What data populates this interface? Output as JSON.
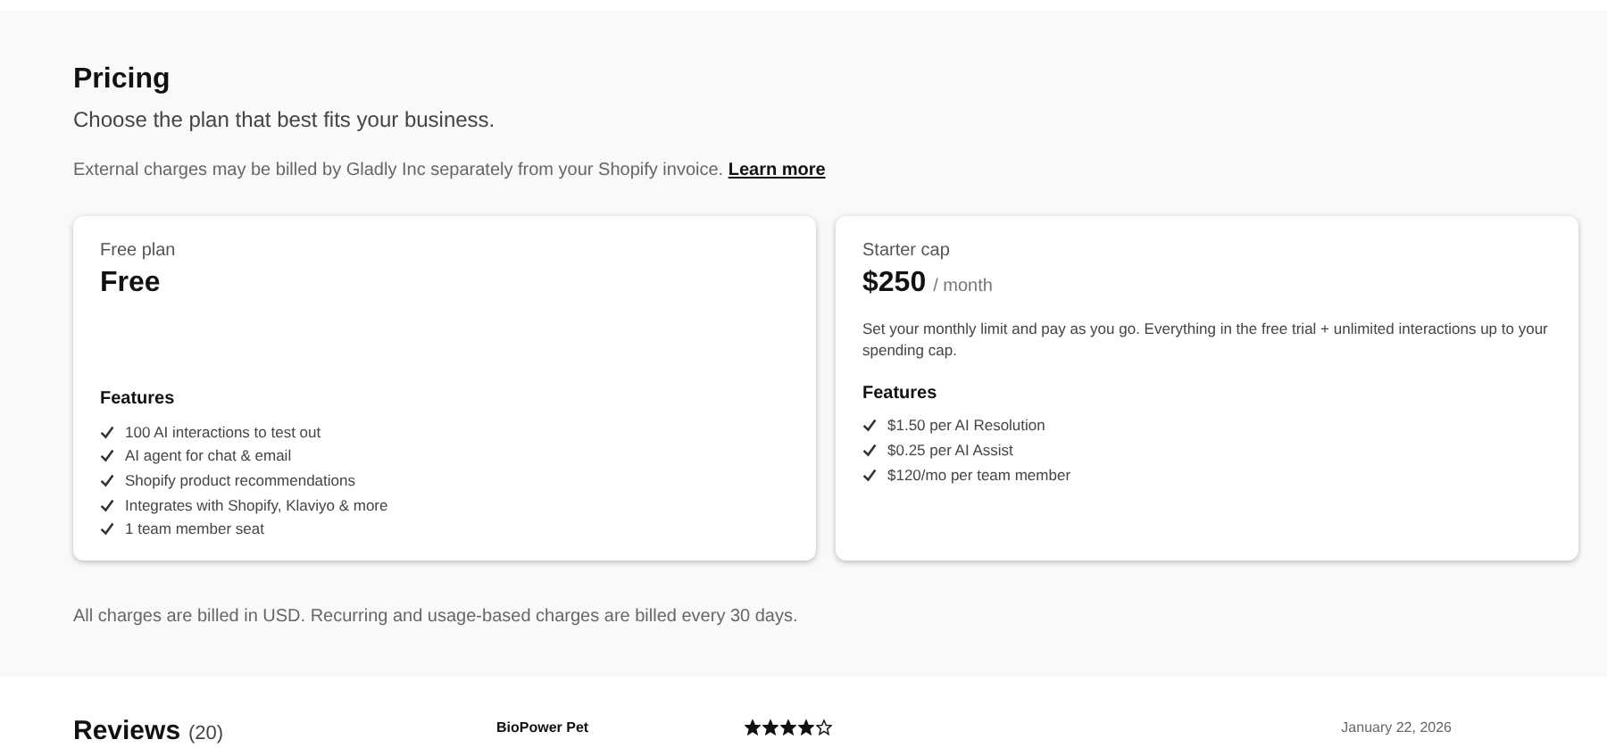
{
  "pricing": {
    "title": "Pricing",
    "subtitle": "Choose the plan that best fits your business.",
    "notice": "External charges may be billed by Gladly Inc separately from your Shopify invoice.",
    "notice_link": "Learn more",
    "plans": [
      {
        "name": "Free plan",
        "price": "Free",
        "features_title": "Features",
        "features": [
          "100 AI interactions to test out",
          "AI agent for chat & email",
          "Shopify product recommendations",
          "Integrates with Shopify, Klaviyo & more",
          "1 team member seat"
        ]
      },
      {
        "name": "Starter cap",
        "price": "$250",
        "period": "/ month",
        "description": "Set your monthly limit and pay as you go. Everything in the free trial + unlimited interactions up to your spending cap.",
        "features_title": "Features",
        "features": [
          "$1.50 per AI Resolution",
          "$0.25 per AI Assist",
          "$120/mo per team member"
        ]
      }
    ],
    "footnote": "All charges are billed in USD. Recurring and usage-based charges are billed every 30 days."
  },
  "reviews": {
    "title": "Reviews",
    "count": "(20)",
    "first": {
      "author": "BioPower Pet",
      "stars": 4,
      "date": "January 22, 2026"
    }
  }
}
